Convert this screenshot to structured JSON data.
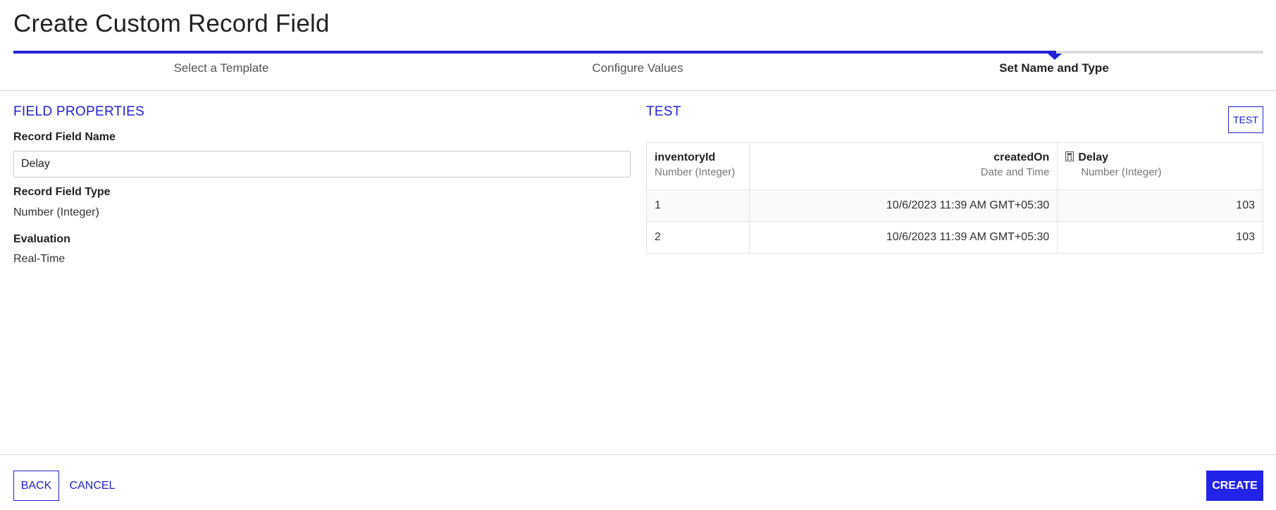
{
  "page": {
    "title": "Create Custom Record Field"
  },
  "stepper": {
    "steps": [
      {
        "label": "Select a Template"
      },
      {
        "label": "Configure Values"
      },
      {
        "label": "Set Name and Type"
      }
    ],
    "current_step": 3,
    "total_steps": 3
  },
  "field_properties": {
    "heading": "FIELD PROPERTIES",
    "name_label": "Record Field Name",
    "name_value": "Delay",
    "type_label": "Record Field Type",
    "type_value": "Number (Integer)",
    "evaluation_label": "Evaluation",
    "evaluation_value": "Real-Time"
  },
  "test": {
    "heading": "TEST",
    "button_label": "TEST",
    "columns": [
      {
        "name": "inventoryId",
        "type": "Number (Integer)"
      },
      {
        "name": "createdOn",
        "type": "Date and Time"
      },
      {
        "name": "Delay",
        "type": "Number (Integer)",
        "icon": "calculator-icon"
      }
    ],
    "rows": [
      [
        "1",
        "10/6/2023 11:39 AM GMT+05:30",
        "103"
      ],
      [
        "2",
        "10/6/2023 11:39 AM GMT+05:30",
        "103"
      ]
    ]
  },
  "footer": {
    "back_label": "BACK",
    "cancel_label": "CANCEL",
    "create_label": "CREATE"
  },
  "colors": {
    "accent": "#2322d8",
    "primary_button": "#2322e8",
    "track": "#dcdcdc"
  }
}
